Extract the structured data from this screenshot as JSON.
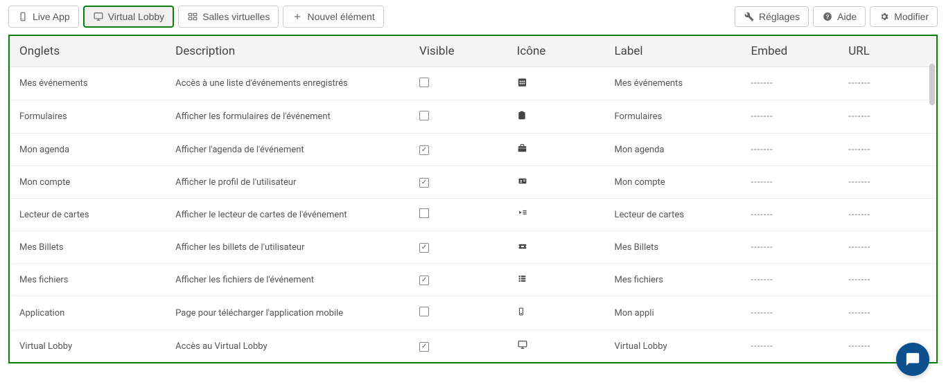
{
  "toolbar": {
    "left": [
      {
        "label": "Live App",
        "icon": "smartphone",
        "active": false
      },
      {
        "label": "Virtual Lobby",
        "icon": "monitor",
        "active": true
      },
      {
        "label": "Salles virtuelles",
        "icon": "rooms",
        "active": false
      },
      {
        "label": "Nouvel élément",
        "icon": "plus",
        "active": false
      }
    ],
    "right": [
      {
        "label": "Réglages",
        "icon": "wrench"
      },
      {
        "label": "Aide",
        "icon": "help"
      },
      {
        "label": "Modifier",
        "icon": "gear"
      }
    ]
  },
  "table": {
    "headers": {
      "onglets": "Onglets",
      "description": "Description",
      "visible": "Visible",
      "icone": "Icône",
      "label": "Label",
      "embed": "Embed",
      "url": "URL"
    },
    "rows": [
      {
        "onglet": "Mes événements",
        "description": "Accès à une liste d'événements enregistrés",
        "visible": false,
        "icon": "calendar-grid",
        "label": "Mes événements",
        "embed": "-------",
        "url": "-------"
      },
      {
        "onglet": "Formulaires",
        "description": "Afficher les formulaires de l'événement",
        "visible": false,
        "icon": "clipboard",
        "label": "Formulaires",
        "embed": "-------",
        "url": "-------"
      },
      {
        "onglet": "Mon agenda",
        "description": "Afficher l'agenda de l'événement",
        "visible": true,
        "icon": "briefcase",
        "label": "Mon agenda",
        "embed": "-------",
        "url": "-------"
      },
      {
        "onglet": "Mon compte",
        "description": "Afficher le profil de l'utilisateur",
        "visible": true,
        "icon": "id-card",
        "label": "Mon compte",
        "embed": "-------",
        "url": "-------"
      },
      {
        "onglet": "Lecteur de cartes",
        "description": "Afficher le lecteur de cartes de l'événement",
        "visible": false,
        "icon": "card-reader",
        "label": "Lecteur de cartes",
        "embed": "-------",
        "url": "-------"
      },
      {
        "onglet": "Mes Billets",
        "description": "Afficher les billets de l'utilisateur",
        "visible": true,
        "icon": "ticket",
        "label": "Mes Billets",
        "embed": "-------",
        "url": "-------"
      },
      {
        "onglet": "Mes fichiers",
        "description": "Afficher les fichiers de l'événement",
        "visible": true,
        "icon": "list",
        "label": "Mes fichiers",
        "embed": "-------",
        "url": "-------"
      },
      {
        "onglet": "Application",
        "description": "Page pour télécharger l'application mobile",
        "visible": false,
        "icon": "phone",
        "label": "Mon appli",
        "embed": "-------",
        "url": "-------"
      },
      {
        "onglet": "Virtual Lobby",
        "description": "Accès au Virtual Lobby",
        "visible": true,
        "icon": "monitor",
        "label": "Virtual Lobby",
        "embed": "-------",
        "url": "-------"
      }
    ]
  }
}
